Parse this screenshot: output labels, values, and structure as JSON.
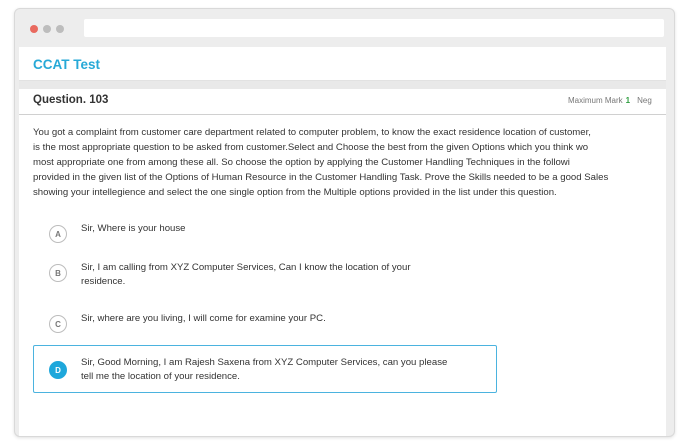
{
  "app": {
    "title": "CCAT Test"
  },
  "question": {
    "number_label": "Question. 103",
    "max_mark_label": "Maximum Mark",
    "max_mark_value": "1",
    "neg_label_partial": "Neg",
    "text_lines": [
      "You got a complaint from customer care department related to computer problem, to know the exact residence location of customer,",
      "is the most appropriate question to be asked from customer.Select and Choose the best from the given Options which you think wo",
      "most appropriate one from among these all. So choose the option by applying the Customer Handling Techniques in the followi",
      "provided in the given list of the Options of Human Resource in the Customer Handling Task. Prove the Skills needed to be a good Sales",
      "showing your intellegience and select the one single option from the Multiple options provided in the list under this question."
    ]
  },
  "options": [
    {
      "letter": "A",
      "lines": [
        "Sir, Where is your house"
      ],
      "selected": false
    },
    {
      "letter": "B",
      "lines": [
        "Sir, I am calling from XYZ Computer Services, Can I know the location of your",
        "residence."
      ],
      "selected": false
    },
    {
      "letter": "C",
      "lines": [
        "Sir, where are you living, I will come for examine your PC."
      ],
      "selected": false
    },
    {
      "letter": "D",
      "lines": [
        "Sir, Good Morning, I am Rajesh Saxena from XYZ Computer Services, can you please",
        "tell me the location of your residence."
      ],
      "selected": true
    }
  ],
  "colors": {
    "accent": "#27a9d7",
    "selected": "#1ea7db",
    "mark_value": "#2e9e3f"
  }
}
